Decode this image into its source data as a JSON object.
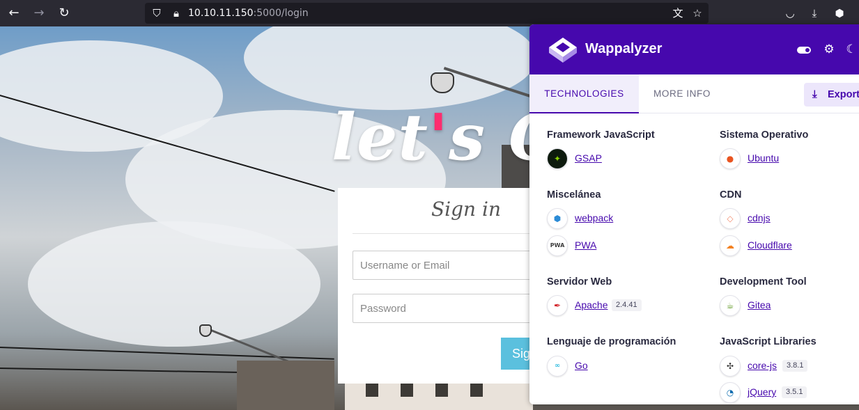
{
  "browser": {
    "url_host": "10.10.11.150",
    "url_path": ":5000/login",
    "nav": {
      "back_icon": "arrow-left-icon",
      "forward_icon": "arrow-right-icon",
      "reload_icon": "reload-icon"
    }
  },
  "page": {
    "hero_title_a": "let",
    "hero_title_apostrophe": "'",
    "hero_title_b": "s Ch",
    "signin_title": "Sign in",
    "username_placeholder": "Username or Email",
    "password_placeholder": "Password",
    "signin_button": "Sig"
  },
  "wappalyzer": {
    "brand": "Wappalyzer",
    "accent": "#4608ad",
    "tabs": {
      "technologies": "TECHNOLOGIES",
      "more_info": "MORE INFO"
    },
    "export_label": "Export",
    "categories": [
      {
        "title": "Framework JavaScript",
        "items": [
          {
            "name": "GSAP",
            "version": ""
          }
        ]
      },
      {
        "title": "Sistema Operativo",
        "items": [
          {
            "name": "Ubuntu",
            "version": ""
          }
        ]
      },
      {
        "title": "Miscelánea",
        "items": [
          {
            "name": "webpack",
            "version": ""
          },
          {
            "name": "PWA",
            "version": ""
          }
        ]
      },
      {
        "title": "CDN",
        "items": [
          {
            "name": "cdnjs",
            "version": ""
          },
          {
            "name": "Cloudflare",
            "version": ""
          }
        ]
      },
      {
        "title": "Servidor Web",
        "items": [
          {
            "name": "Apache",
            "version": "2.4.41"
          }
        ]
      },
      {
        "title": "Development Tool",
        "items": [
          {
            "name": "Gitea",
            "version": ""
          }
        ]
      },
      {
        "title": "Lenguaje de programación",
        "items": [
          {
            "name": "Go",
            "version": ""
          }
        ]
      },
      {
        "title": "JavaScript Libraries",
        "items": [
          {
            "name": "core-js",
            "version": "3.8.1"
          },
          {
            "name": "jQuery",
            "version": "3.5.1"
          }
        ]
      }
    ]
  }
}
